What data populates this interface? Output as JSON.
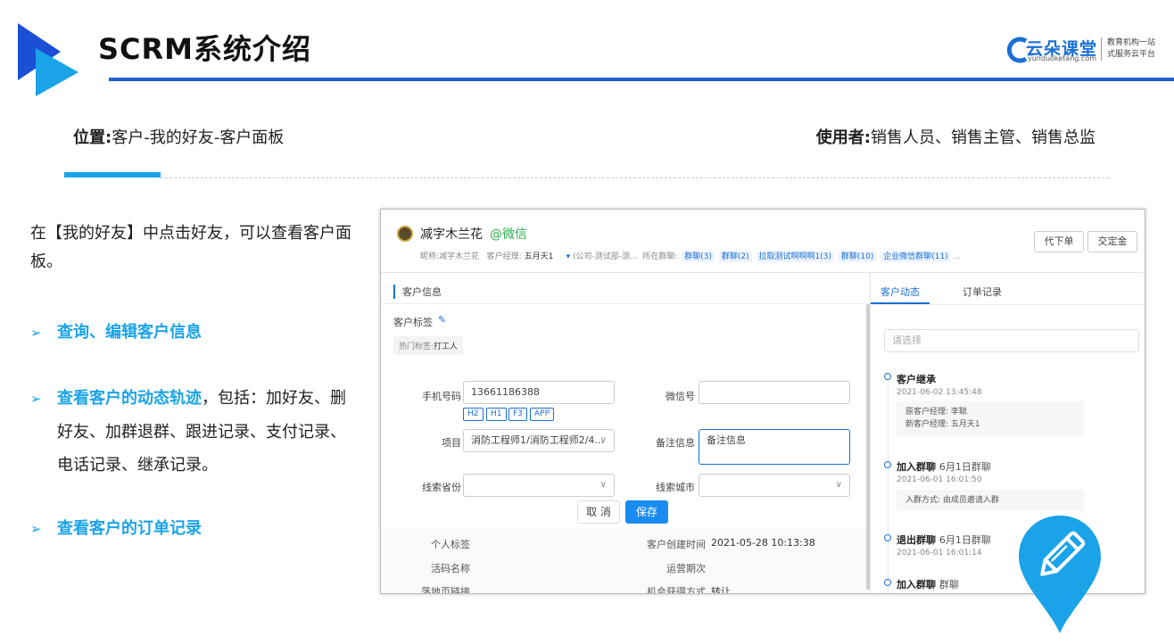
{
  "header": {
    "title": "SCRM系统介绍",
    "brand_name": "云朵课堂",
    "brand_url": "yunduoketang.com",
    "brand_slogan_1": "教育机构一站",
    "brand_slogan_2": "式服务云平台"
  },
  "location": {
    "label": "位置:",
    "value": "客户-我的好友-客户面板",
    "user_label": "使用者:",
    "user_value": "销售人员、销售主管、销售总监"
  },
  "intro": "在【我的好友】中点击好友，可以查看客户面板。",
  "bullets": {
    "b1": "查询、编辑客户信息",
    "b2_hl": "查看客户的动态轨迹",
    "b2_rest": "，包括：加好友、删好友、加群退群、跟进记录、支付记录、电话记录、继承记录。",
    "b3": "查看客户的订单记录",
    "arrow": "➢"
  },
  "panel": {
    "name": "减字木兰花",
    "wechat": "@微信",
    "meta_nick_label": "昵称:",
    "meta_nick": "减字木兰花",
    "meta_mgr_label": "客户经理:",
    "meta_mgr": "五月天1",
    "meta_dept": "(公司-测试部-测...",
    "meta_groups_label": "所在群聊:",
    "groups": [
      "群聊(3)",
      "群聊(2)",
      "拉取测试啊啊啊1(3)",
      "群聊(10)",
      "企业微信群聊(11)"
    ],
    "meta_more": "...",
    "btn_order": "代下单",
    "btn_deposit": "交定金",
    "section_title": "客户信息",
    "tags_label": "客户标签",
    "hot_tag_label": "热门标签:",
    "hot_tag_value": "打工人",
    "phone_label": "手机号码",
    "phone_value": "13661186388",
    "chips": [
      "H2",
      "H1",
      "F3",
      "APP"
    ],
    "wechat_label": "微信号",
    "project_label": "项目",
    "project_value": "消防工程师1/消防工程师2/4...",
    "remark_label": "备注信息",
    "remark_value": "备注信息",
    "province_label": "线索省份",
    "city_label": "线索城市",
    "cancel": "取 消",
    "save": "保存",
    "personal_tag_label": "个人标签",
    "created_label": "客户创建时间",
    "created_value": "2021-05-28 10:13:38",
    "live_code_label": "活码名称",
    "period_label": "运营期次",
    "landing_label": "落地页链接",
    "chance_label": "机会获得方式",
    "chance_value": "转让",
    "tab_dynamic": "客户动态",
    "tab_orders": "订单记录",
    "select_placeholder": "请选择",
    "events": [
      {
        "title": "客户继承",
        "sub": "",
        "time": "2021-06-02 13:45:48",
        "lines": [
          "原客户经理:  李聪",
          "新客户经理:  五月天1"
        ]
      },
      {
        "title": "加入群聊",
        "sub": "6月1日群聊",
        "time": "2021-06-01 16:01:50",
        "lines": [
          "入群方式:     由成员邀请入群"
        ]
      },
      {
        "title": "退出群聊",
        "sub": "6月1日群聊",
        "time": "2021-06-01 16:01:14",
        "lines": []
      },
      {
        "title": "加入群聊",
        "sub": "群聊",
        "time": "",
        "lines": []
      }
    ]
  },
  "colors": {
    "accent": "#1aa3e8",
    "brand_blue": "#1a6fd6",
    "wechat_green": "#2bb24c"
  }
}
